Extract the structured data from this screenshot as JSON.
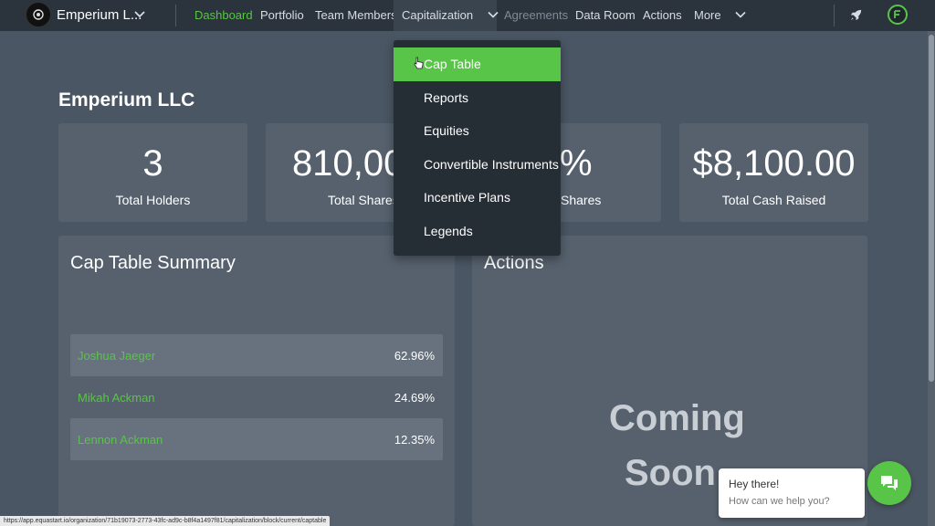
{
  "org": {
    "name": "Emperium L...",
    "logo_icon": "org-logo-icon"
  },
  "nav": {
    "items": [
      {
        "label": "Dashboard"
      },
      {
        "label": "Portfolio"
      },
      {
        "label": "Team Members"
      },
      {
        "label": "Capitalization"
      },
      {
        "label": "Agreements"
      },
      {
        "label": "Data Room"
      },
      {
        "label": "Actions"
      },
      {
        "label": "More"
      }
    ]
  },
  "page": {
    "title": "Emperium LLC"
  },
  "stats": [
    {
      "value": "3",
      "label": "Total Holders"
    },
    {
      "value": "810,00",
      "label": "Total Shares"
    },
    {
      "value": "%",
      "label": "Shares"
    },
    {
      "value": "$8,100.00",
      "label": "Total Cash Raised"
    }
  ],
  "cap_table": {
    "title": "Cap Table Summary",
    "rows": [
      {
        "name": "Joshua Jaeger",
        "percent": "62.96%"
      },
      {
        "name": "Mikah Ackman",
        "percent": "24.69%"
      },
      {
        "name": "Lennon Ackman",
        "percent": "12.35%"
      }
    ]
  },
  "actions_panel": {
    "title": "Actions",
    "placeholder_line1": "Coming",
    "placeholder_line2": "Soon"
  },
  "dropdown": {
    "items": [
      {
        "label": "Cap Table"
      },
      {
        "label": "Reports"
      },
      {
        "label": "Equities"
      },
      {
        "label": "Convertible Instruments"
      },
      {
        "label": "Incentive Plans"
      },
      {
        "label": "Legends"
      }
    ]
  },
  "chat": {
    "greeting": "Hey there!",
    "prompt": "How can we help you?"
  },
  "status_url": "https://app.equastart.io/organization/71b19073-2773-43fc-ad9c-b8f4a1497f81/capitalization/block/current/captable",
  "colors": {
    "accent": "#58c448",
    "topbar": "#2b333c",
    "background": "#4a5663",
    "card": "#56616d",
    "dropdown": "#252d35"
  }
}
